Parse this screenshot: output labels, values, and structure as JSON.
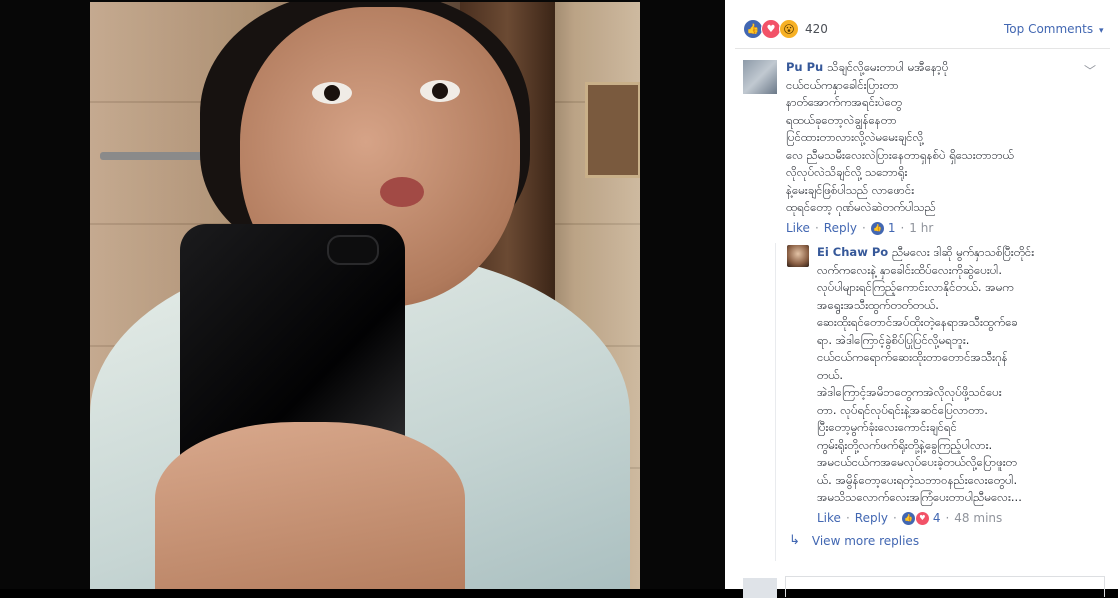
{
  "reactions": {
    "icons": [
      "like-icon",
      "love-icon",
      "wow-icon"
    ],
    "count": "420",
    "top_comments_label": "Top Comments"
  },
  "comments": [
    {
      "author": "Pu Pu",
      "lines": [
        "သိချင်လို့မေးတာပါ မအီနော့ပို",
        "ငယ်ငယ်ကနှာခေါင်းပြားတာ",
        "နာတ်အောက်ကအရင်းပဲတွေ",
        "ရထယ်ခုတော့လဲချွန်နေတာ",
        "ပြင်ထားတာလားလို့လဲမမေးချင်လို့",
        "လေ ညီမသမီးလေးလဲပြားနေတာရှနစ်ပဲ ရှိသေးတာဘယ်",
        "လိုလုပ်လဲသိချင်လို့ သဘောရိုး",
        "နဲ့မေးချင်ဖြစ်ပါသည် လာဖောင်း",
        "ထုရင်တော့ ဂုဏ်မလဲဆဲတက်ပါသည်"
      ],
      "actions": {
        "like": "Like",
        "reply": "Reply",
        "likes_count": "1",
        "time": "1 hr"
      }
    }
  ],
  "reply": {
    "author": "Ei Chaw Po",
    "lines": [
      "ညီမလေး ဒါဆို မွက်နှာသစ်ပြီးတိုင်း",
      "လက်ကလေးနဲ့ နှာခေါင်းထိပ်လေးကိုဆွဲပေးပါ.",
      "လုပ်ပါများရင်ကြည့်ကောင်းလာနိုင်တယ်. အမက",
      "အရွေးအသီးထွက်တတ်တယ်.",
      "ဆေးထိုးရင်တောင်အပ်ထိုးတဲ့နေရာအသီးထွက်ခေ",
      "ရာ. အဲဒါကြောင့်ခွဲစိပ်ပြုပြင်လို့မရဘူး.",
      "ငယ်ငယ်ကရောက်ဆေးထိုးတာတောင်အသီးဂုန်",
      "တယ်.",
      "အဲဒါကြောင့်အမိဘတွေကအဲလိုလုပ်ဖို့သင်ပေး",
      "တာ. လုပ်ရင်လုပ်ရင်းနဲ့အဆင်ပြေလာတာ.",
      "ပြီးတော့မွက်ခုံးလေးကောင်းချင်ရင်",
      "ကွမ်းရိုးတို့လက်ဖက်ရိုးတို့နဲ့ခွေကြည့်ပါလား.",
      "အမငယ်ငယ်ကအမေလုပ်ပေးခဲ့တယ်လို့ပြောဖူးတ",
      "ယ်. အမွိန်တော့ပေးရတဲ့သဘာဝနည်းလေးတွေပါ.",
      "အမသိသလောက်လေးအကြံပေးတာပါညီမလေး..."
    ],
    "actions": {
      "like": "Like",
      "reply": "Reply",
      "likes_count": "4",
      "time": "48 mins"
    }
  },
  "view_more": "View more replies"
}
